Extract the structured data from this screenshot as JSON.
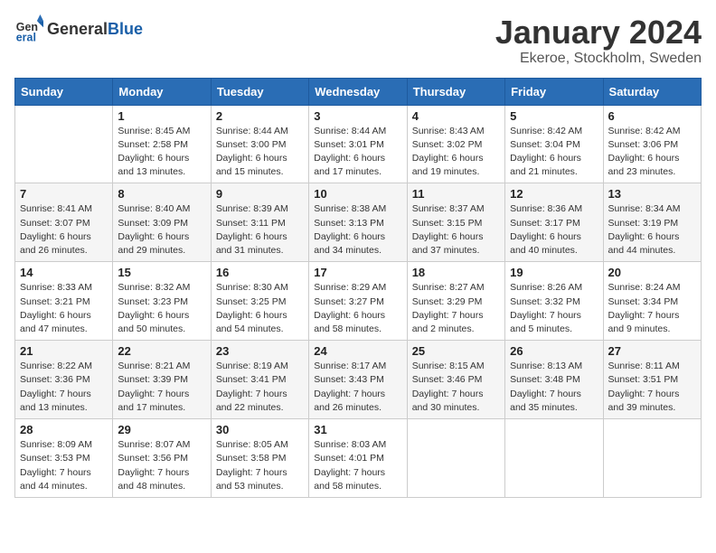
{
  "header": {
    "logo_general": "General",
    "logo_blue": "Blue",
    "title": "January 2024",
    "subtitle": "Ekeroe, Stockholm, Sweden"
  },
  "weekdays": [
    "Sunday",
    "Monday",
    "Tuesday",
    "Wednesday",
    "Thursday",
    "Friday",
    "Saturday"
  ],
  "weeks": [
    [
      {
        "day": "",
        "detail": ""
      },
      {
        "day": "1",
        "detail": "Sunrise: 8:45 AM\nSunset: 2:58 PM\nDaylight: 6 hours\nand 13 minutes."
      },
      {
        "day": "2",
        "detail": "Sunrise: 8:44 AM\nSunset: 3:00 PM\nDaylight: 6 hours\nand 15 minutes."
      },
      {
        "day": "3",
        "detail": "Sunrise: 8:44 AM\nSunset: 3:01 PM\nDaylight: 6 hours\nand 17 minutes."
      },
      {
        "day": "4",
        "detail": "Sunrise: 8:43 AM\nSunset: 3:02 PM\nDaylight: 6 hours\nand 19 minutes."
      },
      {
        "day": "5",
        "detail": "Sunrise: 8:42 AM\nSunset: 3:04 PM\nDaylight: 6 hours\nand 21 minutes."
      },
      {
        "day": "6",
        "detail": "Sunrise: 8:42 AM\nSunset: 3:06 PM\nDaylight: 6 hours\nand 23 minutes."
      }
    ],
    [
      {
        "day": "7",
        "detail": "Sunrise: 8:41 AM\nSunset: 3:07 PM\nDaylight: 6 hours\nand 26 minutes."
      },
      {
        "day": "8",
        "detail": "Sunrise: 8:40 AM\nSunset: 3:09 PM\nDaylight: 6 hours\nand 29 minutes."
      },
      {
        "day": "9",
        "detail": "Sunrise: 8:39 AM\nSunset: 3:11 PM\nDaylight: 6 hours\nand 31 minutes."
      },
      {
        "day": "10",
        "detail": "Sunrise: 8:38 AM\nSunset: 3:13 PM\nDaylight: 6 hours\nand 34 minutes."
      },
      {
        "day": "11",
        "detail": "Sunrise: 8:37 AM\nSunset: 3:15 PM\nDaylight: 6 hours\nand 37 minutes."
      },
      {
        "day": "12",
        "detail": "Sunrise: 8:36 AM\nSunset: 3:17 PM\nDaylight: 6 hours\nand 40 minutes."
      },
      {
        "day": "13",
        "detail": "Sunrise: 8:34 AM\nSunset: 3:19 PM\nDaylight: 6 hours\nand 44 minutes."
      }
    ],
    [
      {
        "day": "14",
        "detail": "Sunrise: 8:33 AM\nSunset: 3:21 PM\nDaylight: 6 hours\nand 47 minutes."
      },
      {
        "day": "15",
        "detail": "Sunrise: 8:32 AM\nSunset: 3:23 PM\nDaylight: 6 hours\nand 50 minutes."
      },
      {
        "day": "16",
        "detail": "Sunrise: 8:30 AM\nSunset: 3:25 PM\nDaylight: 6 hours\nand 54 minutes."
      },
      {
        "day": "17",
        "detail": "Sunrise: 8:29 AM\nSunset: 3:27 PM\nDaylight: 6 hours\nand 58 minutes."
      },
      {
        "day": "18",
        "detail": "Sunrise: 8:27 AM\nSunset: 3:29 PM\nDaylight: 7 hours\nand 2 minutes."
      },
      {
        "day": "19",
        "detail": "Sunrise: 8:26 AM\nSunset: 3:32 PM\nDaylight: 7 hours\nand 5 minutes."
      },
      {
        "day": "20",
        "detail": "Sunrise: 8:24 AM\nSunset: 3:34 PM\nDaylight: 7 hours\nand 9 minutes."
      }
    ],
    [
      {
        "day": "21",
        "detail": "Sunrise: 8:22 AM\nSunset: 3:36 PM\nDaylight: 7 hours\nand 13 minutes."
      },
      {
        "day": "22",
        "detail": "Sunrise: 8:21 AM\nSunset: 3:39 PM\nDaylight: 7 hours\nand 17 minutes."
      },
      {
        "day": "23",
        "detail": "Sunrise: 8:19 AM\nSunset: 3:41 PM\nDaylight: 7 hours\nand 22 minutes."
      },
      {
        "day": "24",
        "detail": "Sunrise: 8:17 AM\nSunset: 3:43 PM\nDaylight: 7 hours\nand 26 minutes."
      },
      {
        "day": "25",
        "detail": "Sunrise: 8:15 AM\nSunset: 3:46 PM\nDaylight: 7 hours\nand 30 minutes."
      },
      {
        "day": "26",
        "detail": "Sunrise: 8:13 AM\nSunset: 3:48 PM\nDaylight: 7 hours\nand 35 minutes."
      },
      {
        "day": "27",
        "detail": "Sunrise: 8:11 AM\nSunset: 3:51 PM\nDaylight: 7 hours\nand 39 minutes."
      }
    ],
    [
      {
        "day": "28",
        "detail": "Sunrise: 8:09 AM\nSunset: 3:53 PM\nDaylight: 7 hours\nand 44 minutes."
      },
      {
        "day": "29",
        "detail": "Sunrise: 8:07 AM\nSunset: 3:56 PM\nDaylight: 7 hours\nand 48 minutes."
      },
      {
        "day": "30",
        "detail": "Sunrise: 8:05 AM\nSunset: 3:58 PM\nDaylight: 7 hours\nand 53 minutes."
      },
      {
        "day": "31",
        "detail": "Sunrise: 8:03 AM\nSunset: 4:01 PM\nDaylight: 7 hours\nand 58 minutes."
      },
      {
        "day": "",
        "detail": ""
      },
      {
        "day": "",
        "detail": ""
      },
      {
        "day": "",
        "detail": ""
      }
    ]
  ]
}
